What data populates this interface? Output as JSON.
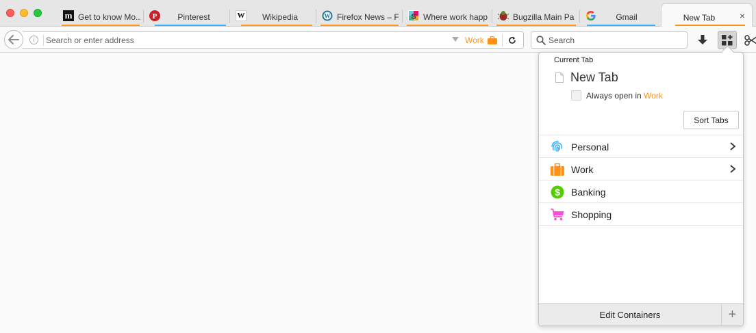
{
  "colors": {
    "work": "#ff9216",
    "personal": "#37adff",
    "banking": "#51cd00",
    "shopping": "#ff4bda",
    "pinterest": "#cb2027",
    "wordpress": "#21759b",
    "gmail_blue": "#4285f4"
  },
  "tabs": [
    {
      "title": "Get to know Mo...",
      "favicon": "m-logo-icon",
      "context_color": "#ff9216"
    },
    {
      "title": "Pinterest",
      "favicon": "pinterest-icon",
      "context_color": "#37adff"
    },
    {
      "title": "Wikipedia",
      "favicon": "wikipedia-icon",
      "context_color": "#ff9216"
    },
    {
      "title": "Firefox News – F",
      "favicon": "wordpress-icon",
      "context_color": "#ff9216"
    },
    {
      "title": "Where work happ",
      "favicon": "slack-icon",
      "context_color": "#ff9216"
    },
    {
      "title": "Bugzilla Main Pa",
      "favicon": "bugzilla-icon",
      "context_color": "#ff9216"
    },
    {
      "title": "Gmail",
      "favicon": "google-icon",
      "context_color": "#37adff"
    }
  ],
  "active_tab": {
    "title": "New Tab",
    "close": "×",
    "context_color": "#ff9216"
  },
  "navbar": {
    "url_placeholder": "Search or enter address",
    "url_value": "",
    "context_label": "Work",
    "search_placeholder": "Search"
  },
  "panel": {
    "heading": "Current Tab",
    "current_tab_title": "New Tab",
    "always_open_prefix": "Always open in ",
    "always_open_context": "Work",
    "always_open_checked": false,
    "sort_label": "Sort Tabs",
    "containers": [
      {
        "name": "Personal",
        "icon": "fingerprint-icon",
        "color": "#37adff",
        "has_chevron": true
      },
      {
        "name": "Work",
        "icon": "briefcase-icon",
        "color": "#ff9216",
        "has_chevron": true
      },
      {
        "name": "Banking",
        "icon": "dollar-icon",
        "color": "#51cd00",
        "has_chevron": false
      },
      {
        "name": "Shopping",
        "icon": "cart-icon",
        "color": "#ff4bda",
        "has_chevron": false
      }
    ],
    "edit_label": "Edit Containers",
    "add_label": "+"
  }
}
